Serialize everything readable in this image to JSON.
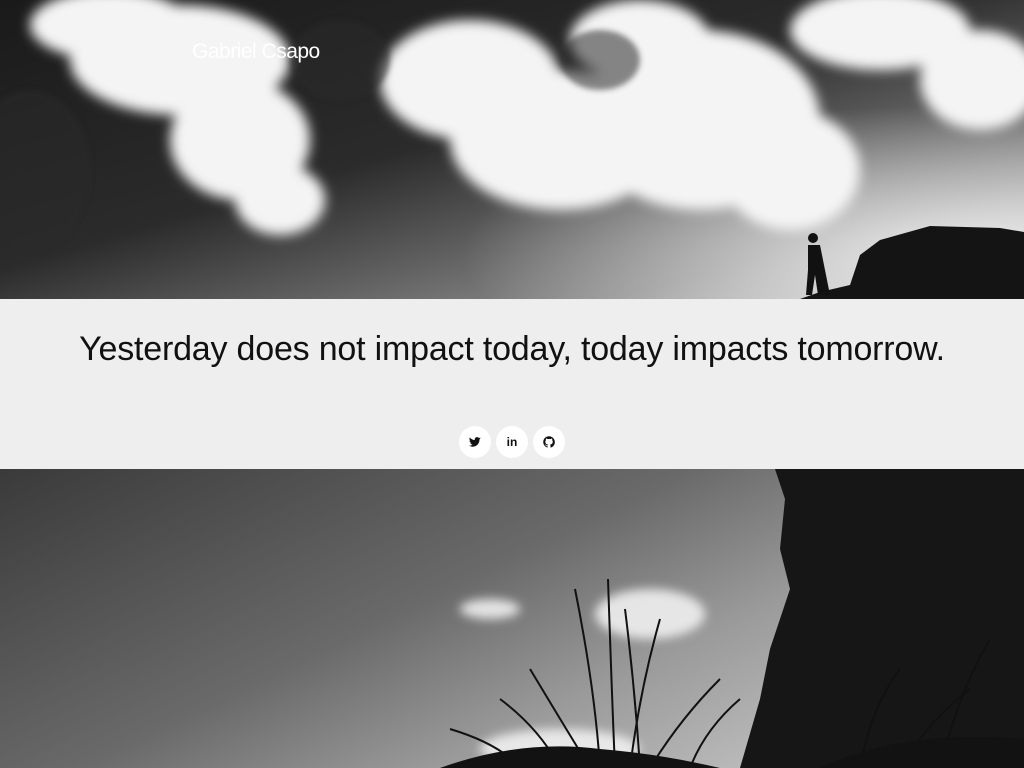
{
  "header": {
    "brand": "Gabriel Csapo"
  },
  "main": {
    "quote": "Yesterday does not impact today, today impacts tomorrow."
  },
  "social": [
    {
      "name": "twitter",
      "icon": "twitter-icon",
      "label": ""
    },
    {
      "name": "linkedin",
      "icon": "linkedin-icon",
      "label": "in"
    },
    {
      "name": "github",
      "icon": "github-icon",
      "label": ""
    }
  ],
  "colors": {
    "band_background": "#eeeeee",
    "text": "#111111",
    "button_background": "#ffffff"
  }
}
